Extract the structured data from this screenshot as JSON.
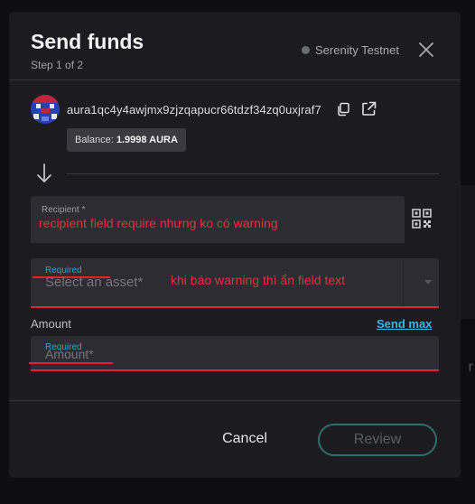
{
  "modal": {
    "title": "Send funds",
    "step": "Step 1 of 2",
    "network": "Serenity Testnet"
  },
  "account": {
    "address": "aura1qc4y4awjmx9zjzqapucr66tdzf34zq0uxjraf7",
    "balance_label": "Balance:",
    "balance_value": "1.9998 AURA"
  },
  "recipient": {
    "label": "Recipient *",
    "annotation": "recipient field require nhưng ko có warning"
  },
  "asset": {
    "required": "Required",
    "placeholder": "Select an asset*",
    "annotation": "khi báo warning thì ẩn field text"
  },
  "amount": {
    "label": "Amount",
    "send_max": "Send max",
    "required": "Required",
    "placeholder": "Amount*"
  },
  "footer": {
    "cancel": "Cancel",
    "review": "Review"
  },
  "colors": {
    "accent": "#3fb4e6",
    "error": "#d9262f",
    "review_border": "#2d6f6c"
  }
}
